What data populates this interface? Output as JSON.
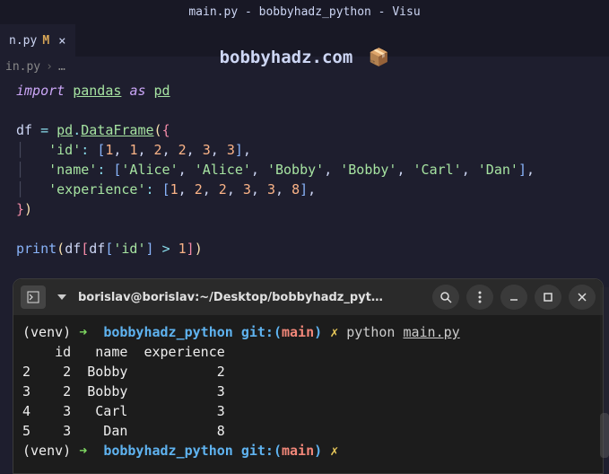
{
  "window": {
    "title": "main.py - bobbyhadz_python - Visu"
  },
  "tab": {
    "filename": "n.py",
    "status": "M"
  },
  "watermark": {
    "text": "bobbyhadz.com",
    "icon": "📦"
  },
  "breadcrumb": {
    "file": "in.py",
    "more": "…"
  },
  "code": {
    "l1_import": "import",
    "l1_pandas": "pandas",
    "l1_as": "as",
    "l1_pd": "pd",
    "l3_df": "df",
    "l3_eq": "=",
    "l3_pd": "pd",
    "l3_dot": ".",
    "l3_dataframe": "DataFrame",
    "l3_open": "({",
    "l4_key": "'id'",
    "l4_vals": [
      "1",
      "1",
      "2",
      "2",
      "3",
      "3"
    ],
    "l5_key": "'name'",
    "l5_vals": [
      "'Alice'",
      "'Alice'",
      "'Bobby'",
      "'Bobby'",
      "'Carl'",
      "'Dan'"
    ],
    "l6_key": "'experience'",
    "l6_vals": [
      "1",
      "2",
      "2",
      "3",
      "3",
      "8"
    ],
    "l7_close": "})",
    "l9_print": "print",
    "l9_df": "df",
    "l9_col": "'id'",
    "l9_gt": ">",
    "l9_one": "1"
  },
  "terminal": {
    "titlepath": "borislav@borislav:~/Desktop/bobbyhadz_pyt…",
    "prompt_venv": "(venv)",
    "prompt_arrow": "➜",
    "prompt_dir": "bobbyhadz_python",
    "prompt_git": "git:",
    "prompt_branch": "main",
    "prompt_x": "✗",
    "cmd_py": "python",
    "cmd_file": "main.py",
    "out_header": "    id   name  experience",
    "out_rows": [
      "2    2  Bobby           2",
      "3    2  Bobby           3",
      "4    3   Carl           3",
      "5    3    Dan           8"
    ]
  }
}
